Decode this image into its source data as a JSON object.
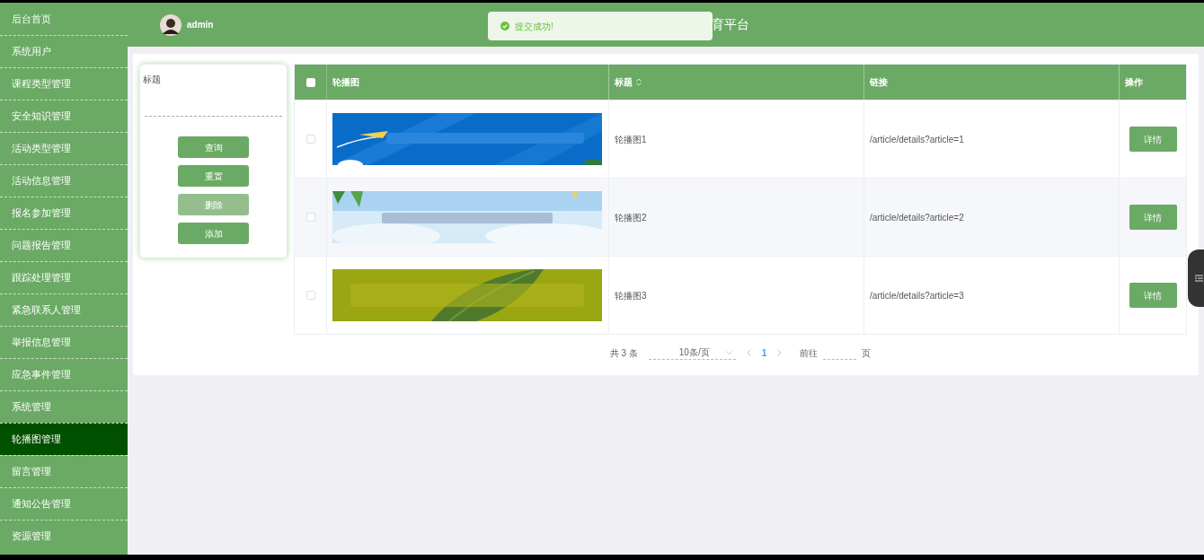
{
  "sidebar": {
    "items": [
      {
        "label": "后台首页",
        "selected": false
      },
      {
        "label": "系统用户",
        "selected": false
      },
      {
        "label": "课程类型管理",
        "selected": false
      },
      {
        "label": "安全知识管理",
        "selected": false
      },
      {
        "label": "活动类型管理",
        "selected": false
      },
      {
        "label": "活动信息管理",
        "selected": false
      },
      {
        "label": "报名参加管理",
        "selected": false
      },
      {
        "label": "问题报告管理",
        "selected": false
      },
      {
        "label": "跟踪处理管理",
        "selected": false
      },
      {
        "label": "紧急联系人管理",
        "selected": false
      },
      {
        "label": "举报信息管理",
        "selected": false
      },
      {
        "label": "应急事件管理",
        "selected": false
      },
      {
        "label": "系统管理",
        "selected": false
      },
      {
        "label": "轮播图管理",
        "selected": true
      },
      {
        "label": "留言管理",
        "selected": false
      },
      {
        "label": "通知公告管理",
        "selected": false
      },
      {
        "label": "资源管理",
        "selected": false
      }
    ]
  },
  "header": {
    "user": "admin",
    "title": "育平台"
  },
  "toast": {
    "message": "提交成功!"
  },
  "search": {
    "label": "标题",
    "buttons": [
      {
        "label": "查询",
        "disabled": false
      },
      {
        "label": "重置",
        "disabled": false
      },
      {
        "label": "删除",
        "disabled": true
      },
      {
        "label": "添加",
        "disabled": false
      }
    ]
  },
  "table": {
    "columns": [
      "轮播图",
      "标题",
      "链接",
      "操作"
    ],
    "select_all_checked": false,
    "rows": [
      {
        "checked": false,
        "title": "轮播图1",
        "link": "/article/details?article=1",
        "action": "详情"
      },
      {
        "checked": false,
        "title": "轮播图2",
        "link": "/article/details?article=2",
        "action": "详情"
      },
      {
        "checked": false,
        "title": "轮播图3",
        "link": "/article/details?article=3",
        "action": "详情"
      }
    ]
  },
  "pagination": {
    "total": "共 3 条",
    "page_size": "10条/页",
    "pages": [
      {
        "label": "1",
        "selected": true
      }
    ],
    "goto": "前往",
    "page_unit": "页"
  }
}
